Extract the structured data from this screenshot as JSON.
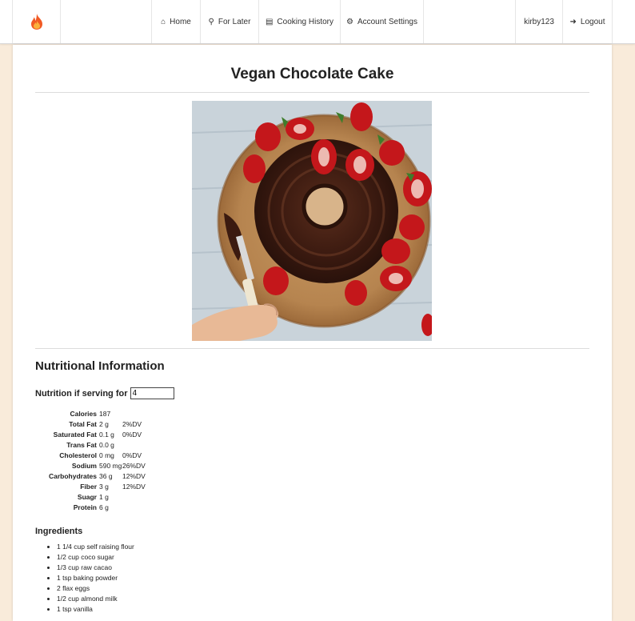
{
  "nav": {
    "items": [
      {
        "label": "Home",
        "icon": "home-icon",
        "glyph": "⌂"
      },
      {
        "label": "For Later",
        "icon": "pin-icon",
        "glyph": "⚲"
      },
      {
        "label": "Cooking History",
        "icon": "book-icon",
        "glyph": "▤"
      },
      {
        "label": "Account Settings",
        "icon": "gears-icon",
        "glyph": "⚙"
      }
    ],
    "username": "kirby123",
    "logout": {
      "label": "Logout",
      "glyph": "➜"
    }
  },
  "recipe": {
    "title": "Vegan Chocolate Cake"
  },
  "nutrition": {
    "heading": "Nutritional Information",
    "serving_label": "Nutrition if serving for",
    "serving_value": "4",
    "rows": [
      {
        "label": "Calories",
        "amount": "187",
        "dv": ""
      },
      {
        "label": "Total Fat",
        "amount": "2 g",
        "dv": "2%DV"
      },
      {
        "label": "Saturated Fat",
        "amount": "0.1 g",
        "dv": "0%DV"
      },
      {
        "label": "Trans Fat",
        "amount": "0.0 g",
        "dv": ""
      },
      {
        "label": "Cholesterol",
        "amount": "0 mg",
        "dv": "0%DV"
      },
      {
        "label": "Sodium",
        "amount": "590 mg",
        "dv": "26%DV"
      },
      {
        "label": "Carbohydrates",
        "amount": "36 g",
        "dv": "12%DV"
      },
      {
        "label": "Fiber",
        "amount": "3 g",
        "dv": "12%DV"
      },
      {
        "label": "Suagr",
        "amount": "1 g",
        "dv": ""
      },
      {
        "label": "Protein",
        "amount": "6 g",
        "dv": ""
      }
    ]
  },
  "ingredients": {
    "heading": "Ingredients",
    "items": [
      "1 1/4 cup self raising flour",
      "1/2 cup coco sugar",
      "1/3 cup raw cacao",
      "1 tsp baking powder",
      "2 flax eggs",
      "1/2 cup almond milk",
      "1 tsp vanilla"
    ]
  },
  "colors": {
    "page_bg": "#f9ebda",
    "flame": "#f15a24",
    "flame_inner": "#fbb03b"
  }
}
